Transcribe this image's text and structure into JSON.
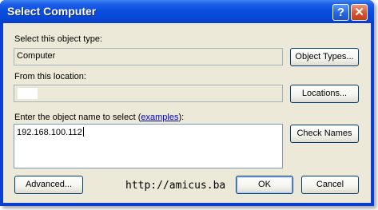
{
  "window": {
    "title": "Select Computer"
  },
  "titlebar_buttons": {
    "help_glyph": "?",
    "close_glyph": "✕"
  },
  "object_type": {
    "label": "Select this object type:",
    "value": "Computer",
    "button": "Object Types..."
  },
  "location": {
    "label": "From this location:",
    "value": "",
    "button": "Locations..."
  },
  "object_name": {
    "label_prefix": "Enter the object name to select (",
    "link": "examples",
    "label_suffix": "):",
    "value": "192.168.100.112",
    "button": "Check Names"
  },
  "footer": {
    "advanced": "Advanced...",
    "watermark": "http://amicus.ba",
    "ok": "OK",
    "cancel": "Cancel"
  },
  "colors": {
    "titlebar": "#0b4fe0",
    "dialog_bg": "#ece9d8",
    "close_button": "#d8532a",
    "link": "#0000cc"
  }
}
